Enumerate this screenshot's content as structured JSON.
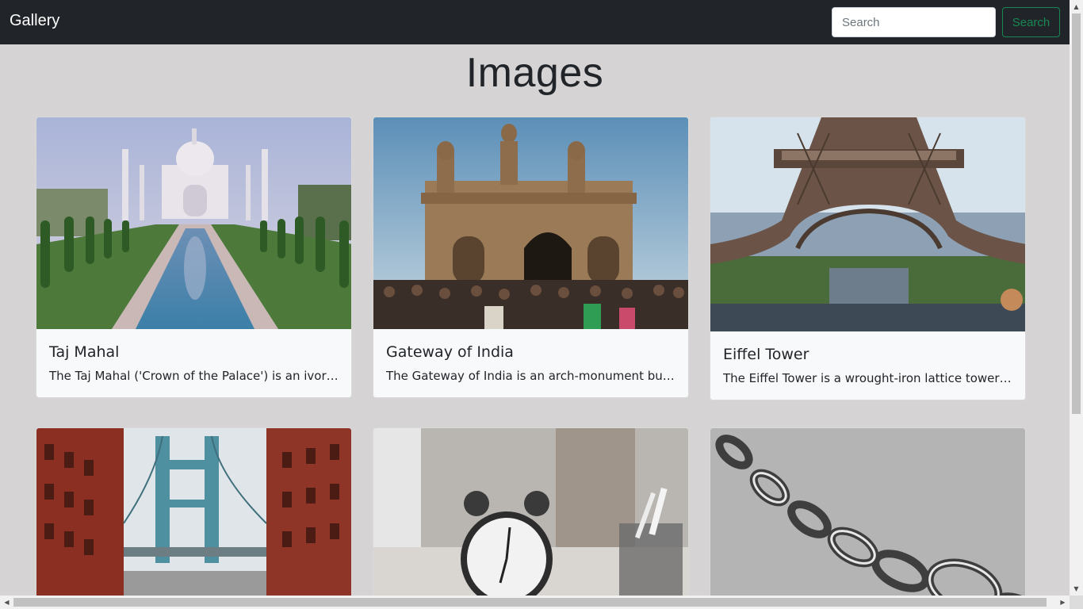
{
  "navbar": {
    "brand": "Gallery",
    "search_placeholder": "Search",
    "search_button": "Search"
  },
  "page": {
    "title": "Images"
  },
  "cards": [
    {
      "title": "Taj Mahal",
      "text": "The Taj Mahal ('Crown of the Palace') is an ivory-white marble mausoleum",
      "image": "taj-mahal-photo"
    },
    {
      "title": "Gateway of India",
      "text": "The Gateway of India is an arch-monument built in the early twentieth century",
      "image": "gateway-of-india-photo"
    },
    {
      "title": "Eiffel Tower",
      "text": "The Eiffel Tower is a wrought-iron lattice tower on the Champ de Mars",
      "image": "eiffel-tower-photo"
    },
    {
      "title": "",
      "text": "",
      "image": "manhattan-bridge-photo"
    },
    {
      "title": "",
      "text": "",
      "image": "alarm-clock-photo"
    },
    {
      "title": "",
      "text": "",
      "image": "chain-links-photo"
    }
  ],
  "colors": {
    "navbar": "#212529",
    "background": "#d5d3d4",
    "search_button": "#198754"
  }
}
